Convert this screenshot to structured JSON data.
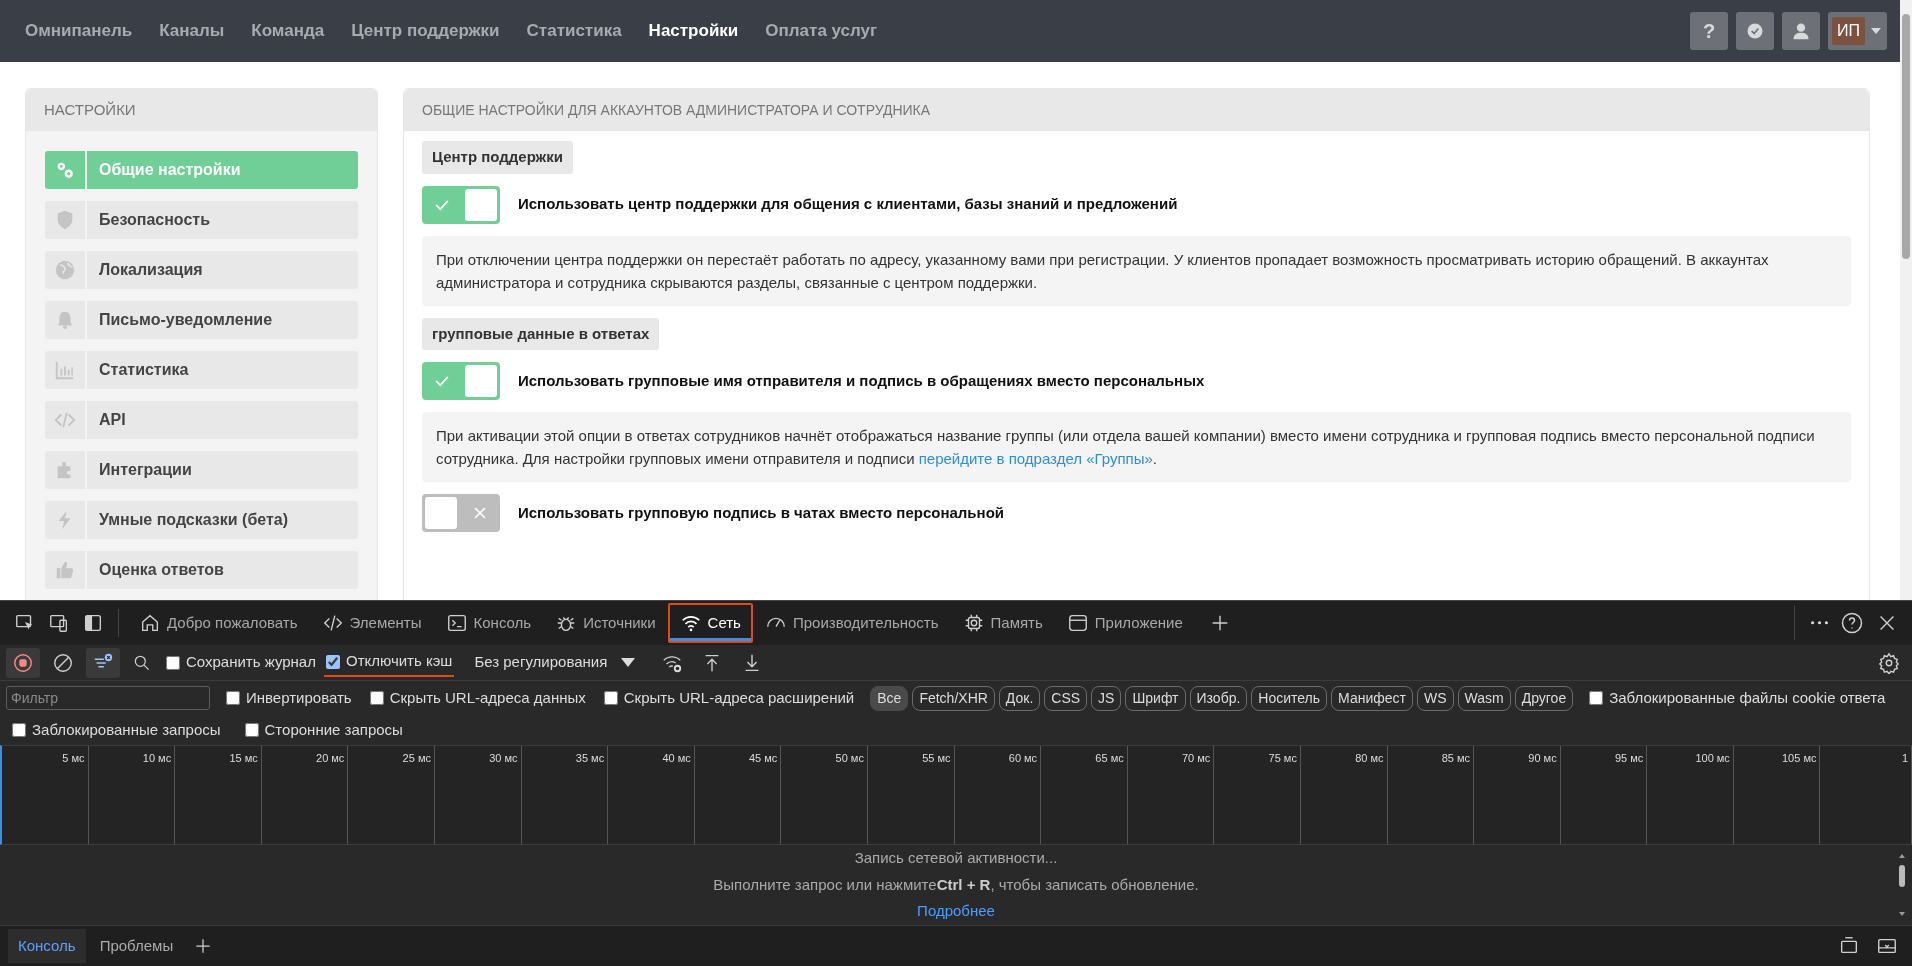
{
  "top_nav": {
    "items": [
      {
        "label": "Омнипанель",
        "selected": false
      },
      {
        "label": "Каналы",
        "selected": false
      },
      {
        "label": "Команда",
        "selected": false
      },
      {
        "label": "Центр поддержки",
        "selected": false
      },
      {
        "label": "Статистика",
        "selected": false
      },
      {
        "label": "Настройки",
        "selected": true
      },
      {
        "label": "Оплата услуг",
        "selected": false
      }
    ],
    "help_button": "?",
    "avatar": "ИП"
  },
  "sidebar": {
    "title": "НАСТРОЙКИ",
    "items": [
      {
        "label": "Общие настройки",
        "selected": true
      },
      {
        "label": "Безопасность",
        "selected": false
      },
      {
        "label": "Локализация",
        "selected": false
      },
      {
        "label": "Письмо-уведомление",
        "selected": false
      },
      {
        "label": "Статистика",
        "selected": false
      },
      {
        "label": "API",
        "selected": false
      },
      {
        "label": "Интеграции",
        "selected": false
      },
      {
        "label": "Умные подсказки (бета)",
        "selected": false
      },
      {
        "label": "Оценка ответов",
        "selected": false
      }
    ]
  },
  "main": {
    "title": "ОБЩИЕ НАСТРОЙКИ ДЛЯ АККАУНТОВ АДМИНИСТРАТОРА И СОТРУДНИКА",
    "blocks": [
      {
        "kind": "section",
        "label": "Центр поддержки"
      },
      {
        "kind": "toggle",
        "label": "Использовать центр поддержки для общения с клиентами, базы знаний и предложений",
        "on": true
      },
      {
        "kind": "note",
        "text": "При отключении центра поддержки он перестаёт работать по адресу, указанному вами при регистрации. У клиентов пропадает возможность просматривать историю обращений. В аккаунтах администратора и сотрудника скрываются разделы, связанные с центром поддержки."
      },
      {
        "kind": "section",
        "label": "групповые данные в ответах"
      },
      {
        "kind": "toggle",
        "label": "Использовать групповые имя отправителя и подпись в обращениях вместо персональных",
        "on": true
      },
      {
        "kind": "note",
        "text": "При активации этой опции в ответах сотрудников начнёт отображаться название группы (или отдела вашей компании) вместо имени сотрудника и групповая подпись вместо персональной подписи сотрудника. Для настройки групповых имени отправителя и подписи ",
        "link": "перейдите в подраздел «Группы»",
        "text_after": "."
      },
      {
        "kind": "toggle",
        "label": "Использовать групповую подпись в чатах вместо персональной",
        "on": false
      }
    ]
  },
  "devtools": {
    "tabs": [
      {
        "label": "Добро пожаловать",
        "selected": false,
        "highlighted": false
      },
      {
        "label": "Элементы",
        "selected": false,
        "highlighted": false
      },
      {
        "label": "Консоль",
        "selected": false,
        "highlighted": false
      },
      {
        "label": "Источники",
        "selected": false,
        "highlighted": false
      },
      {
        "label": "Сеть",
        "selected": true,
        "highlighted": true
      },
      {
        "label": "Производительность",
        "selected": false,
        "highlighted": false
      },
      {
        "label": "Память",
        "selected": false,
        "highlighted": false
      },
      {
        "label": "Приложение",
        "selected": false,
        "highlighted": false
      }
    ],
    "recording": true,
    "toolbar_checkboxes": [
      {
        "label": "Сохранить журнал",
        "checked": false,
        "highlighted": false
      },
      {
        "label": "Отключить кэш",
        "checked": true,
        "highlighted": true
      }
    ],
    "throttling": "Без регулирования",
    "filter": {
      "placeholder": "Фильтр"
    },
    "filter_checkboxes": [
      {
        "label": "Инвертировать",
        "checked": false
      },
      {
        "label": "Скрыть URL-адреса данных",
        "checked": false
      },
      {
        "label": "Скрыть URL-адреса расширений",
        "checked": false
      }
    ],
    "type_filters": [
      {
        "label": "Все",
        "selected": true
      },
      {
        "label": "Fetch/XHR",
        "selected": false
      },
      {
        "label": "Док.",
        "selected": false
      },
      {
        "label": "CSS",
        "selected": false
      },
      {
        "label": "JS",
        "selected": false
      },
      {
        "label": "Шрифт",
        "selected": false
      },
      {
        "label": "Изобр.",
        "selected": false
      },
      {
        "label": "Носитель",
        "selected": false
      },
      {
        "label": "Манифест",
        "selected": false
      },
      {
        "label": "WS",
        "selected": false
      },
      {
        "label": "Wasm",
        "selected": false
      },
      {
        "label": "Другое",
        "selected": false
      }
    ],
    "cookie_checkbox": {
      "label": "Заблокированные файлы cookie ответа",
      "checked": false
    },
    "request_checkboxes": [
      {
        "label": "Заблокированные запросы",
        "checked": false
      },
      {
        "label": "Сторонние запросы",
        "checked": false
      }
    ],
    "timeline_ticks": [
      "5 мс",
      "10 мс",
      "15 мс",
      "20 мс",
      "25 мс",
      "30 мс",
      "35 мс",
      "40 мс",
      "45 мс",
      "50 мс",
      "55 мс",
      "60 мс",
      "65 мс",
      "70 мс",
      "75 мс",
      "80 мс",
      "85 мс",
      "90 мс",
      "95 мс",
      "100 мс",
      "105 мс",
      "1"
    ],
    "empty_state": {
      "title": "Запись сетевой активности...",
      "hint_before": "Выполните запрос или нажмите",
      "shortcut_key": "Ctrl",
      "shortcut_plus": "+",
      "shortcut_letter": "R",
      "hint_after": ", чтобы записать обновление.",
      "link": "Подробнее"
    },
    "drawer_tabs": [
      {
        "label": "Консоль",
        "selected": true
      },
      {
        "label": "Проблемы",
        "selected": false
      }
    ]
  }
}
